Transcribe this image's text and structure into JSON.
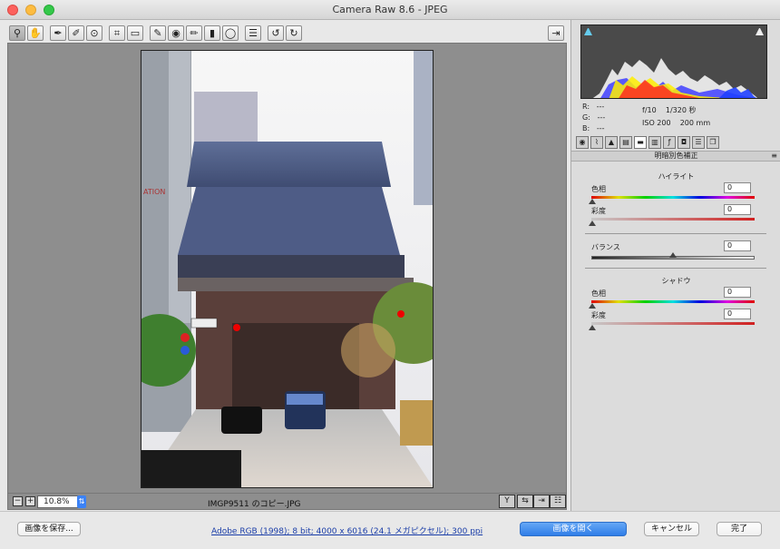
{
  "window": {
    "title": "Camera Raw 8.6  -  JPEG"
  },
  "toolbar": {
    "tools": [
      {
        "name": "zoom-tool",
        "glyph": "🔍",
        "active": true
      },
      {
        "name": "hand-tool",
        "glyph": "✋"
      },
      {
        "name": "white-balance-tool",
        "glyph": "✎"
      },
      {
        "name": "color-sampler-tool",
        "glyph": "✒"
      },
      {
        "name": "target-adjustment-tool",
        "glyph": "⊕"
      },
      {
        "name": "crop-tool",
        "glyph": "⊡"
      },
      {
        "name": "straighten-tool",
        "glyph": "▭"
      },
      {
        "name": "spot-removal-tool",
        "glyph": "✍"
      },
      {
        "name": "red-eye-tool",
        "glyph": "◉"
      },
      {
        "name": "adjustment-brush-tool",
        "glyph": "✏"
      },
      {
        "name": "graduated-filter-tool",
        "glyph": "▮"
      },
      {
        "name": "radial-filter-tool",
        "glyph": "◯"
      },
      {
        "name": "preferences-tool",
        "glyph": "☰"
      },
      {
        "name": "rotate-left-tool",
        "glyph": "↺"
      },
      {
        "name": "rotate-right-tool",
        "glyph": "↻"
      }
    ]
  },
  "preview": {
    "zoom": "10.8%",
    "filename": "IMGP9511 のコピー.JPG"
  },
  "info": {
    "r_label": "R:",
    "r_value": "---",
    "g_label": "G:",
    "g_value": "---",
    "b_label": "B:",
    "b_value": "---",
    "aperture": "f/10",
    "shutter": "1/320 秒",
    "iso": "ISO 200",
    "focal": "200 mm"
  },
  "panel": {
    "title": "明暗別色補正",
    "highlights": {
      "heading": "ハイライト",
      "hue_label": "色相",
      "hue_value": "0",
      "sat_label": "彩度",
      "sat_value": "0"
    },
    "balance": {
      "label": "バランス",
      "value": "0"
    },
    "shadows": {
      "heading": "シャドウ",
      "hue_label": "色相",
      "hue_value": "0",
      "sat_label": "彩度",
      "sat_value": "0"
    }
  },
  "bottom": {
    "save_label": "画像を保存...",
    "workflow_link": "Adobe RGB (1998); 8 bit; 4000 x 6016 (24.1 メガピクセル); 300 ppi",
    "open_label": "画像を開く",
    "cancel_label": "キャンセル",
    "done_label": "完了"
  },
  "colors": {
    "accent": "#2f7de8"
  }
}
